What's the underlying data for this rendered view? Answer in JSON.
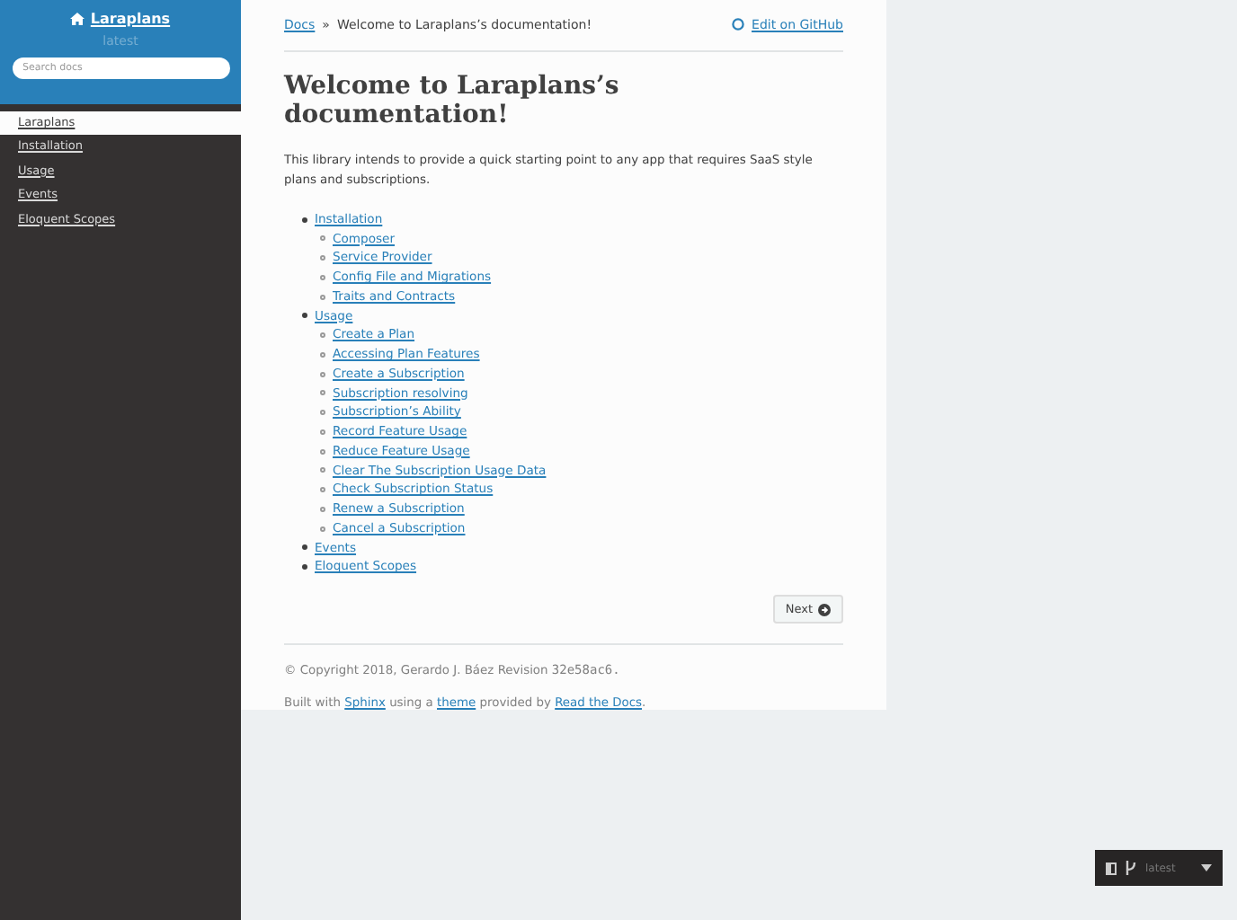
{
  "sidebar": {
    "project": "Laraplans",
    "version": "latest",
    "search": {
      "placeholder": "Search docs"
    },
    "items": [
      {
        "label": "Laraplans",
        "selected": true
      },
      {
        "label": "Installation",
        "selected": false
      },
      {
        "label": "Usage",
        "selected": false
      },
      {
        "label": "Events",
        "selected": false
      },
      {
        "label": "Eloquent Scopes",
        "selected": false
      }
    ]
  },
  "breadcrumbs": {
    "root": "Docs",
    "separator": "»",
    "current": "Welcome to Laraplans’s documentation!"
  },
  "edit_link": "Edit on GitHub",
  "heading": "Welcome to Laraplans’s documentation!",
  "intro": "This library intends to provide a quick starting point to any app that requires SaaS style plans and subscriptions.",
  "toc": [
    {
      "label": "Installation",
      "children": [
        {
          "label": "Composer"
        },
        {
          "label": "Service Provider"
        },
        {
          "label": "Config File and Migrations"
        },
        {
          "label": "Traits and Contracts"
        }
      ]
    },
    {
      "label": "Usage",
      "children": [
        {
          "label": "Create a Plan"
        },
        {
          "label": "Accessing Plan Features"
        },
        {
          "label": "Create a Subscription"
        },
        {
          "label": "Subscription resolving"
        },
        {
          "label": "Subscription’s Ability"
        },
        {
          "label": "Record Feature Usage"
        },
        {
          "label": "Reduce Feature Usage"
        },
        {
          "label": "Clear The Subscription Usage Data"
        },
        {
          "label": "Check Subscription Status"
        },
        {
          "label": "Renew a Subscription"
        },
        {
          "label": "Cancel a Subscription"
        }
      ]
    },
    {
      "label": "Events"
    },
    {
      "label": "Eloquent Scopes"
    }
  ],
  "next_button": "Next",
  "footer": {
    "copyright": "© Copyright 2018, Gerardo J. Báez",
    "revision_label": "Revision",
    "revision": "32e58ac6.",
    "built_with": [
      {
        "kind": "text",
        "text": "Built with"
      },
      {
        "kind": "link",
        "text": "Sphinx"
      },
      {
        "kind": "text",
        "text": "using a"
      },
      {
        "kind": "link",
        "text": "theme"
      },
      {
        "kind": "text",
        "text": "provided by"
      },
      {
        "kind": "link",
        "text": "Read the Docs"
      },
      {
        "kind": "text",
        "text": "."
      }
    ]
  },
  "versions_badge": {
    "version": "latest"
  }
}
